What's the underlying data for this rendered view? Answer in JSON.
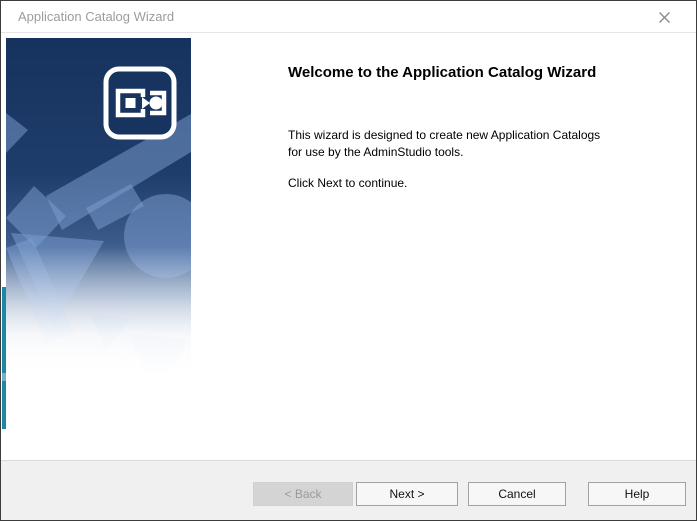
{
  "window": {
    "title": "Application Catalog Wizard"
  },
  "icons": {
    "close": "✕",
    "app_catalog": "application-catalog-glyph"
  },
  "sidebar": {
    "description": "decorative blue gradient watermark with geometric shapes and white application-catalog icon"
  },
  "main": {
    "heading": "Welcome to the Application Catalog Wizard",
    "paragraph_lines": [
      "This wizard is designed to create new Application Catalogs",
      "for use by the AdminStudio tools."
    ],
    "instruction": "Click Next to continue."
  },
  "buttons": {
    "back": {
      "label": "< Back",
      "enabled": false
    },
    "next": {
      "label": "Next >",
      "enabled": true
    },
    "cancel": {
      "label": "Cancel",
      "enabled": true
    },
    "help": {
      "label": "Help",
      "enabled": true
    }
  },
  "colors": {
    "sidebar_navy": "#16325e",
    "sidebar_shape_blue": "#4c6f9f",
    "teal_accent": "#1e87a6",
    "footer_bg": "#f0f0f0",
    "button_border": "#a2a2a2",
    "disabled_button_bg": "#d4d4d4",
    "disabled_text": "#9b9b9b",
    "title_text": "#9c9c9c"
  }
}
